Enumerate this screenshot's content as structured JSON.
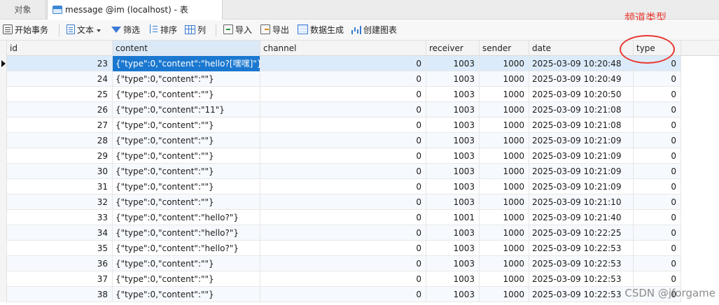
{
  "tabs": {
    "objects_label": "对象",
    "message_label": "message @im (localhost) - 表"
  },
  "annotation": {
    "text": "频道类型",
    "color": "#e8382f"
  },
  "toolbar": {
    "begin_transaction": "开始事务",
    "text": "文本",
    "filter": "筛选",
    "sort": "排序",
    "columns": "列",
    "import": "导入",
    "export": "导出",
    "data_gen": "数据生成",
    "create_chart": "创建图表"
  },
  "grid": {
    "columns": [
      "id",
      "content",
      "channel",
      "receiver",
      "sender",
      "date",
      "type"
    ],
    "rows": [
      [
        "23",
        "{\"type\":0,\"content\":\"hello?[嘿嘿]\"}",
        "0",
        "1003",
        "1000",
        "2025-03-09 10:20:48",
        "0"
      ],
      [
        "24",
        "{\"type\":0,\"content\":\"\"}",
        "0",
        "1003",
        "1000",
        "2025-03-09 10:20:49",
        "0"
      ],
      [
        "25",
        "{\"type\":0,\"content\":\"\"}",
        "0",
        "1003",
        "1000",
        "2025-03-09 10:20:50",
        "0"
      ],
      [
        "26",
        "{\"type\":0,\"content\":\"11\"}",
        "0",
        "1003",
        "1000",
        "2025-03-09 10:21:08",
        "0"
      ],
      [
        "27",
        "{\"type\":0,\"content\":\"\"}",
        "0",
        "1003",
        "1000",
        "2025-03-09 10:21:08",
        "0"
      ],
      [
        "28",
        "{\"type\":0,\"content\":\"\"}",
        "0",
        "1003",
        "1000",
        "2025-03-09 10:21:09",
        "0"
      ],
      [
        "29",
        "{\"type\":0,\"content\":\"\"}",
        "0",
        "1003",
        "1000",
        "2025-03-09 10:21:09",
        "0"
      ],
      [
        "30",
        "{\"type\":0,\"content\":\"\"}",
        "0",
        "1003",
        "1000",
        "2025-03-09 10:21:09",
        "0"
      ],
      [
        "31",
        "{\"type\":0,\"content\":\"\"}",
        "0",
        "1003",
        "1000",
        "2025-03-09 10:21:09",
        "0"
      ],
      [
        "32",
        "{\"type\":0,\"content\":\"\"}",
        "0",
        "1003",
        "1000",
        "2025-03-09 10:21:10",
        "0"
      ],
      [
        "33",
        "{\"type\":0,\"content\":\"hello?\"}",
        "0",
        "1001",
        "1000",
        "2025-03-09 10:21:40",
        "0"
      ],
      [
        "34",
        "{\"type\":0,\"content\":\"hello?\"}",
        "0",
        "1003",
        "1000",
        "2025-03-09 10:22:25",
        "0"
      ],
      [
        "35",
        "{\"type\":0,\"content\":\"hello?\"}",
        "0",
        "1003",
        "1000",
        "2025-03-09 10:22:53",
        "0"
      ],
      [
        "36",
        "{\"type\":0,\"content\":\"\"}",
        "0",
        "1003",
        "1000",
        "2025-03-09 10:22:53",
        "0"
      ],
      [
        "37",
        "{\"type\":0,\"content\":\"\"}",
        "0",
        "1003",
        "1000",
        "2025-03-09 10:22:53",
        "0"
      ],
      [
        "38",
        "{\"type\":0,\"content\":\"\"}",
        "0",
        "1003",
        "1000",
        "2025-03-09 10:22:53",
        "0"
      ]
    ]
  },
  "watermark": "CSDN @jforgame"
}
